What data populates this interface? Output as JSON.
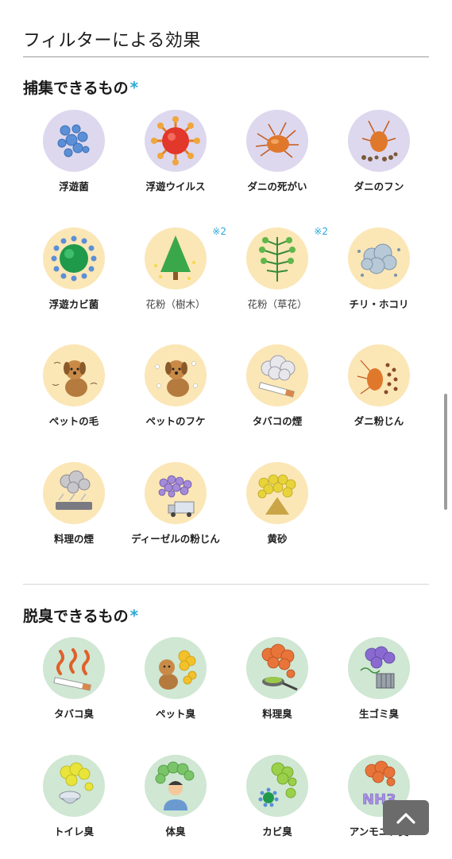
{
  "section_title": "フィルターによる効果",
  "capture": {
    "heading": "捕集できるもの",
    "asterisk": "*",
    "items": [
      {
        "label": "浮遊菌",
        "icon": "airborne-bacteria-icon"
      },
      {
        "label": "浮遊ウイルス",
        "icon": "virus-icon"
      },
      {
        "label": "ダニの死がい",
        "icon": "dead-mite-icon"
      },
      {
        "label": "ダニのフン",
        "icon": "mite-droppings-icon"
      },
      {
        "label": "浮遊カビ菌",
        "icon": "mold-spore-icon"
      },
      {
        "label": "花粉（樹木）",
        "icon": "tree-pollen-icon",
        "note": "※2"
      },
      {
        "label": "花粉（草花）",
        "icon": "grass-pollen-icon",
        "note": "※2"
      },
      {
        "label": "チリ・ホコリ",
        "icon": "dust-icon"
      },
      {
        "label": "ペットの毛",
        "icon": "pet-hair-icon"
      },
      {
        "label": "ペットのフケ",
        "icon": "pet-dander-icon"
      },
      {
        "label": "タバコの煙",
        "icon": "cigarette-smoke-icon"
      },
      {
        "label": "ダニ粉じん",
        "icon": "mite-dust-icon"
      },
      {
        "label": "料理の煙",
        "icon": "cooking-smoke-icon"
      },
      {
        "label": "ディーゼルの粉じん",
        "icon": "diesel-dust-icon"
      },
      {
        "label": "黄砂",
        "icon": "yellow-sand-icon"
      }
    ]
  },
  "deodorize": {
    "heading": "脱臭できるもの",
    "asterisk": "*",
    "items": [
      {
        "label": "タバコ臭",
        "icon": "tobacco-odor-icon"
      },
      {
        "label": "ペット臭",
        "icon": "pet-odor-icon"
      },
      {
        "label": "料理臭",
        "icon": "cooking-odor-icon"
      },
      {
        "label": "生ゴミ臭",
        "icon": "garbage-odor-icon"
      },
      {
        "label": "トイレ臭",
        "icon": "toilet-odor-icon"
      },
      {
        "label": "体臭",
        "icon": "body-odor-icon"
      },
      {
        "label": "カビ臭",
        "icon": "mold-odor-icon"
      },
      {
        "label": "アンモニア臭",
        "icon": "ammonia-odor-icon",
        "overlay_text": "NH3"
      }
    ]
  },
  "back_to_top_icon": "chevron-up-icon",
  "colors": {
    "accent": "#2aa8d8",
    "capture_bg_purple": "#ddd8ee",
    "capture_bg_yellow": "#fbe6b6",
    "deodorize_bg": "#cfe7d3"
  }
}
